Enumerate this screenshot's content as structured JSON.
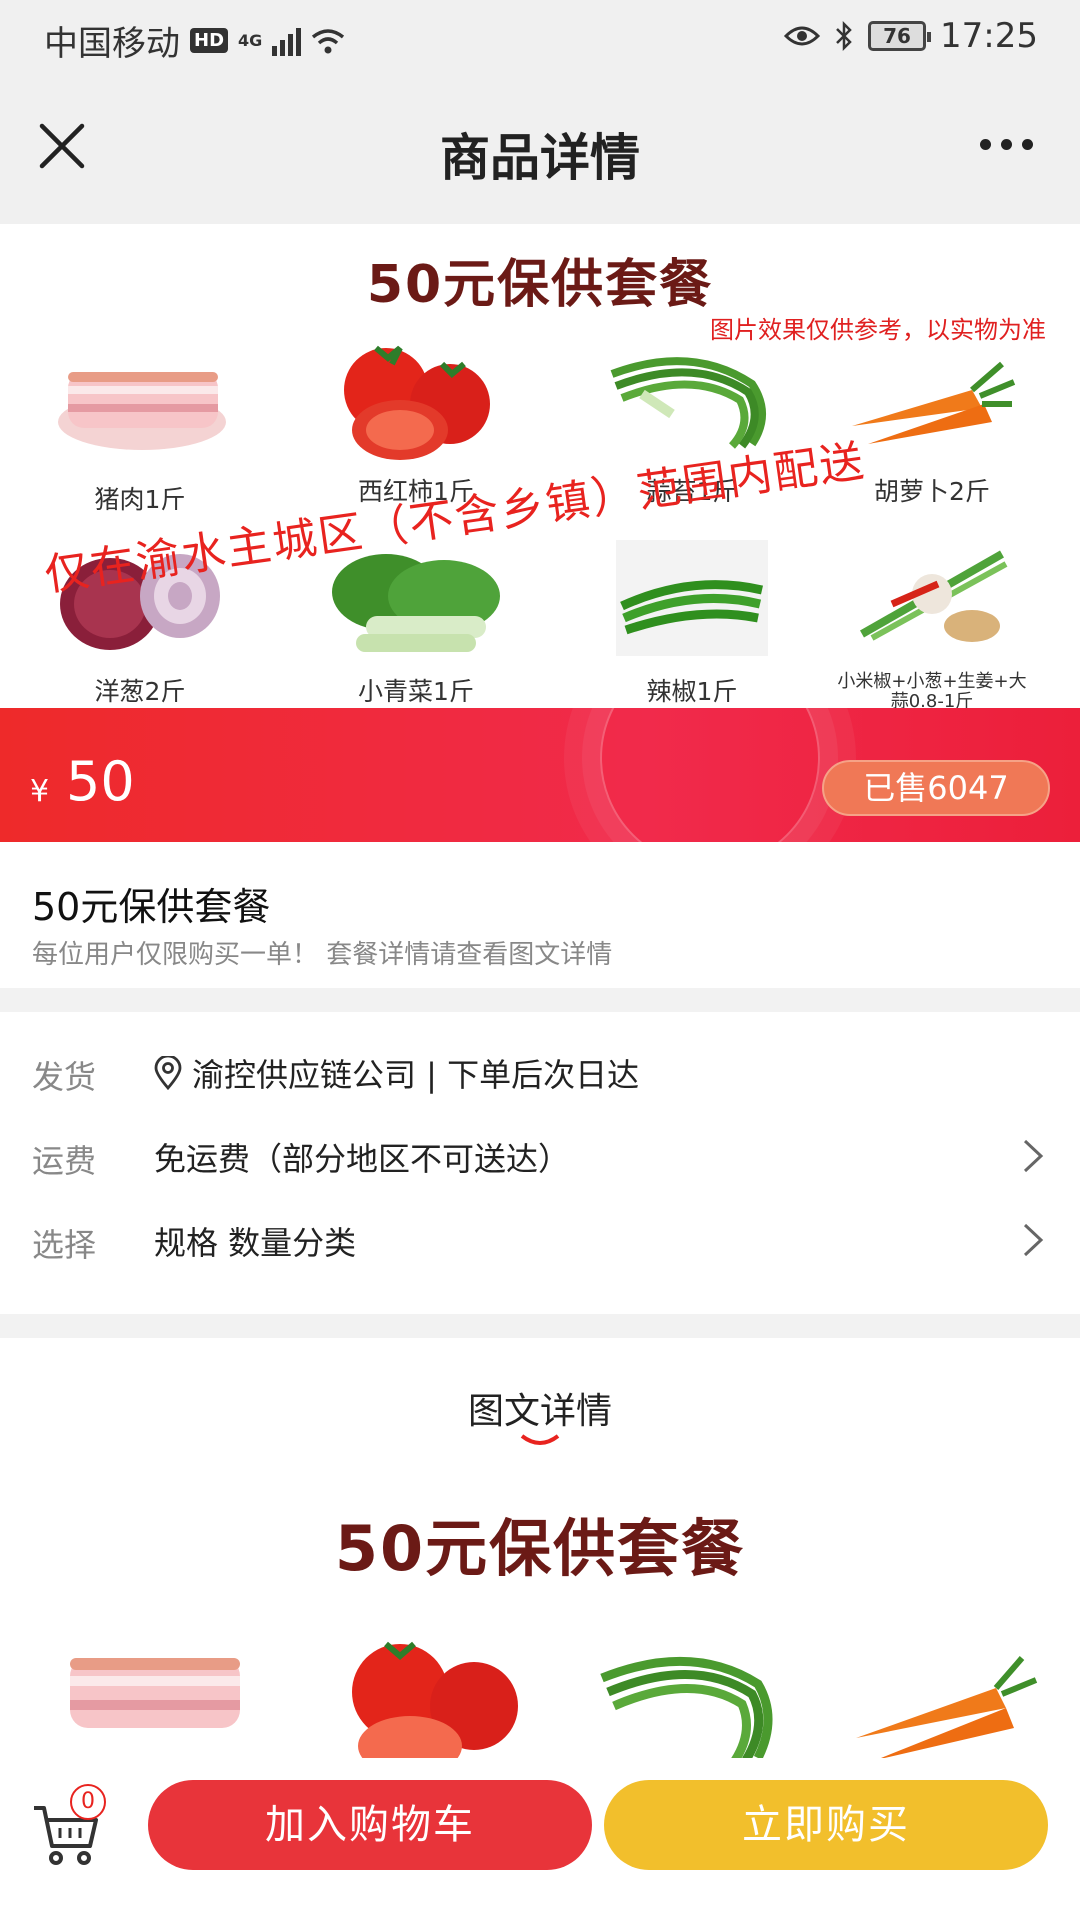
{
  "status_bar": {
    "carrier": "中国移动",
    "hd_badge": "HD",
    "network": "4G",
    "battery": "76",
    "time": "17:25"
  },
  "navbar": {
    "title": "商品详情"
  },
  "banner": {
    "title": "50元保供套餐",
    "note": "图片效果仅供参考，以实物为准",
    "overlay": "仅在渝水主城区（不含乡镇）范围内配送",
    "items": [
      {
        "label": "猪肉1斤",
        "icon": "pork-icon"
      },
      {
        "label": "西红柿1斤",
        "icon": "tomato-icon"
      },
      {
        "label": "蒜苔1斤",
        "icon": "garlic-shoot-icon"
      },
      {
        "label": "胡萝卜2斤",
        "icon": "carrot-icon"
      },
      {
        "label": "洋葱2斤",
        "icon": "onion-icon"
      },
      {
        "label": "小青菜1斤",
        "icon": "bok-choy-icon"
      },
      {
        "label": "辣椒1斤",
        "icon": "pepper-icon"
      },
      {
        "label": "小米椒+小葱+生姜+大蒜0.8-1斤",
        "icon": "seasoning-icon"
      }
    ]
  },
  "price_bar": {
    "currency": "¥",
    "price": "50",
    "sold": "已售6047"
  },
  "product": {
    "title": "50元保供套餐",
    "subtitle": "每位用户仅限购买一单！ 套餐详情请查看图文详情"
  },
  "details": {
    "shipping_key": "发货",
    "shipping_value": "渝控供应链公司 | 下单后次日达",
    "fee_key": "运费",
    "fee_value": "免运费（部分地区不可送达）",
    "select_key": "选择",
    "select_value": "规格 数量分类"
  },
  "graphic": {
    "section_title": "图文详情",
    "banner_title": "50元保供套餐"
  },
  "bottom_bar": {
    "cart_count": "0",
    "add_to_cart": "加入购物车",
    "buy_now": "立即购买"
  },
  "colors": {
    "accent_red": "#e8343a",
    "accent_yellow": "#f2bf2c",
    "title_brown": "#6b1a16"
  }
}
